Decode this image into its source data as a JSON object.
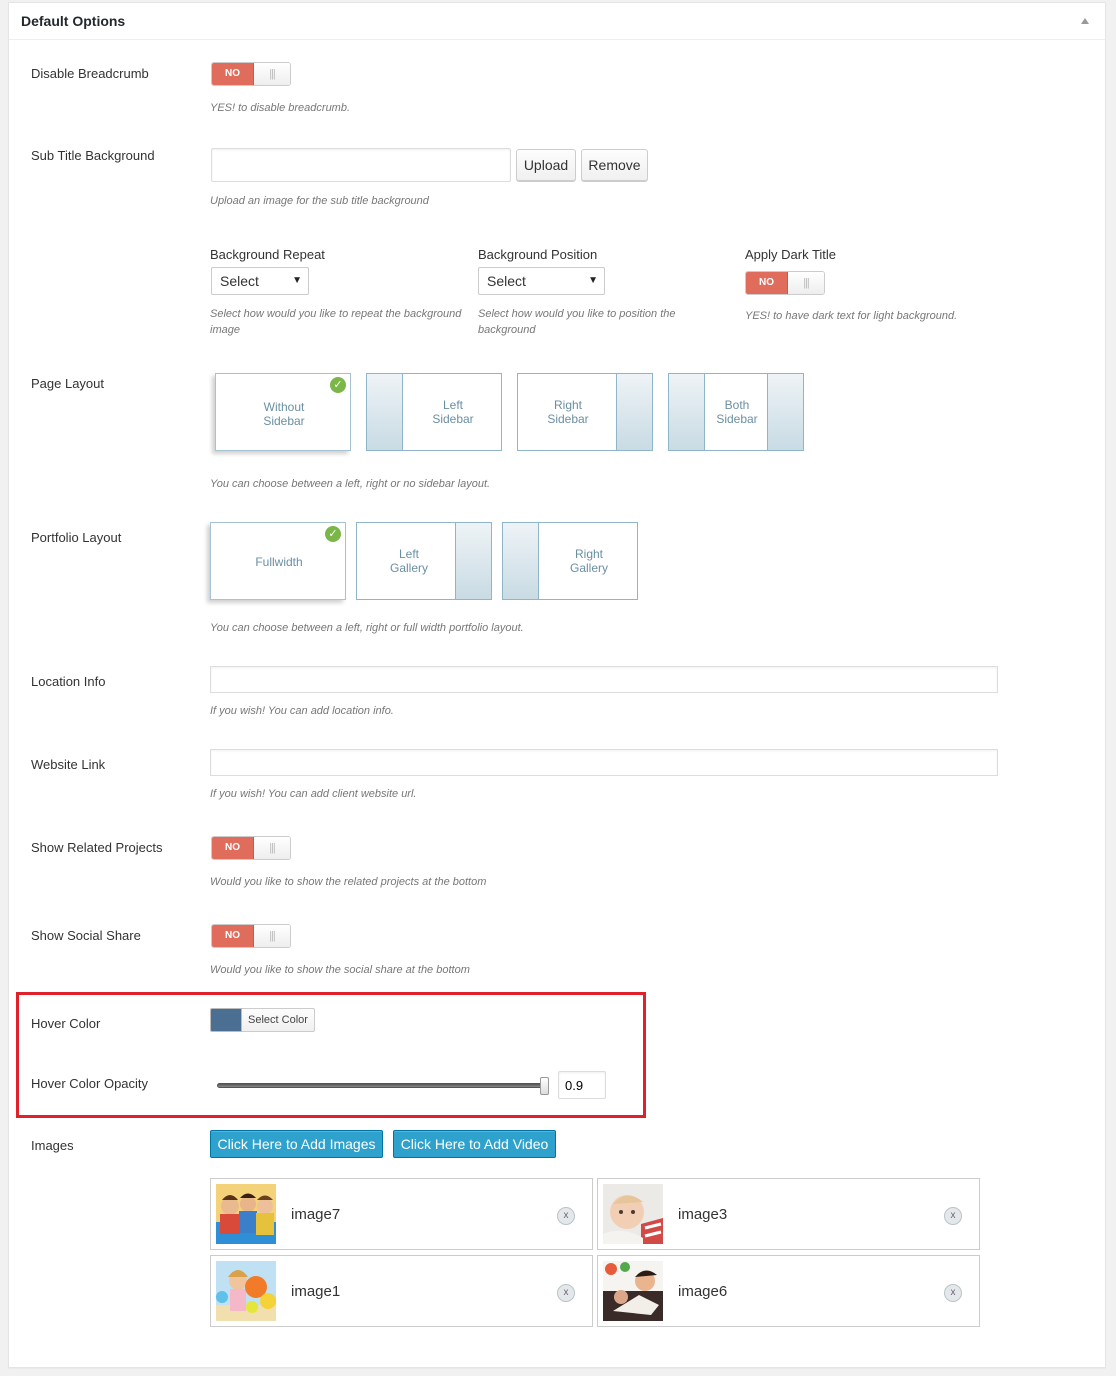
{
  "panel": {
    "title": "Default Options"
  },
  "fields": {
    "disable_breadcrumb": {
      "label": "Disable Breadcrumb",
      "toggle": "NO",
      "desc": "YES! to disable breadcrumb."
    },
    "subtitle_bg": {
      "label": "Sub Title Background",
      "value": "",
      "upload_label": "Upload",
      "remove_label": "Remove",
      "desc": "Upload an image for the sub title background"
    },
    "bg_repeat": {
      "label": "Background Repeat",
      "value": "Select",
      "desc": "Select how would you like to repeat the background image"
    },
    "bg_position": {
      "label": "Background Position",
      "value": "Select",
      "desc": "Select how would you like to position the background"
    },
    "dark_title": {
      "label": "Apply Dark Title",
      "toggle": "NO",
      "desc": "YES! to have dark text for light background."
    },
    "page_layout": {
      "label": "Page Layout",
      "options": [
        {
          "line1": "Without",
          "line2": "Sidebar"
        },
        {
          "line1": "Left",
          "line2": "Sidebar"
        },
        {
          "line1": "Right",
          "line2": "Sidebar"
        },
        {
          "line1": "Both",
          "line2": "Sidebar"
        }
      ],
      "selected": "Without Sidebar",
      "desc": "You can choose between a left, right or no sidebar layout."
    },
    "portfolio_layout": {
      "label": "Portfolio Layout",
      "options": [
        {
          "line1": "Fullwidth",
          "line2": ""
        },
        {
          "line1": "Left",
          "line2": "Gallery"
        },
        {
          "line1": "Right",
          "line2": "Gallery"
        }
      ],
      "selected": "Fullwidth",
      "desc": "You can choose between a left, right or full width portfolio layout."
    },
    "location_info": {
      "label": "Location Info",
      "value": "",
      "desc": "If you wish! You can add location info."
    },
    "website_link": {
      "label": "Website Link",
      "value": "",
      "desc": "If you wish! You can add client website url."
    },
    "related_projects": {
      "label": "Show Related Projects",
      "toggle": "NO",
      "desc": "Would you like to show the related projects at the bottom"
    },
    "social_share": {
      "label": "Show Social Share",
      "toggle": "NO",
      "desc": "Would you like to show the social share at the bottom"
    },
    "hover_color": {
      "label": "Hover Color",
      "button": "Select Color",
      "color": "#4a6f93"
    },
    "hover_opacity": {
      "label": "Hover Color Opacity",
      "value": "0.9",
      "level": 0.9
    },
    "images": {
      "label": "Images",
      "add_images": "Click Here to Add Images",
      "add_video": "Click Here to Add Video",
      "items": [
        {
          "name": "image7",
          "remove": "x"
        },
        {
          "name": "image3",
          "remove": "x"
        },
        {
          "name": "image1",
          "remove": "x"
        },
        {
          "name": "image6",
          "remove": "x"
        }
      ]
    }
  },
  "colors": {
    "toggle_off": "#e06c5c",
    "accent_blue": "#2ea2cc",
    "highlight_red": "#e0202a",
    "check_green": "#7ab648"
  }
}
